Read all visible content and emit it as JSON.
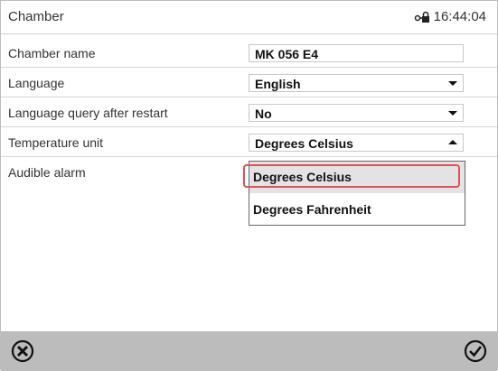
{
  "header": {
    "title": "Chamber",
    "time": "16:44:04",
    "lock_icon": "network-lock-icon"
  },
  "settings": [
    {
      "label": "Chamber name",
      "value": "MK 056 E4",
      "control": "text"
    },
    {
      "label": "Language",
      "value": "English",
      "control": "dropdown"
    },
    {
      "label": "Language query after restart",
      "value": "No",
      "control": "dropdown"
    },
    {
      "label": "Temperature unit",
      "value": "Degrees Celsius",
      "control": "dropdown-open"
    },
    {
      "label": "Audible alarm",
      "value": "",
      "control": "none"
    }
  ],
  "dropdown": {
    "options": [
      "Degrees Celsius",
      "Degrees Fahrenheit"
    ],
    "selected": "Degrees Celsius",
    "highlight_color": "#e05058"
  },
  "footer": {
    "cancel_icon": "cancel-x-circle-icon",
    "confirm_icon": "confirm-check-circle-icon",
    "background": "#bcbcbc"
  }
}
